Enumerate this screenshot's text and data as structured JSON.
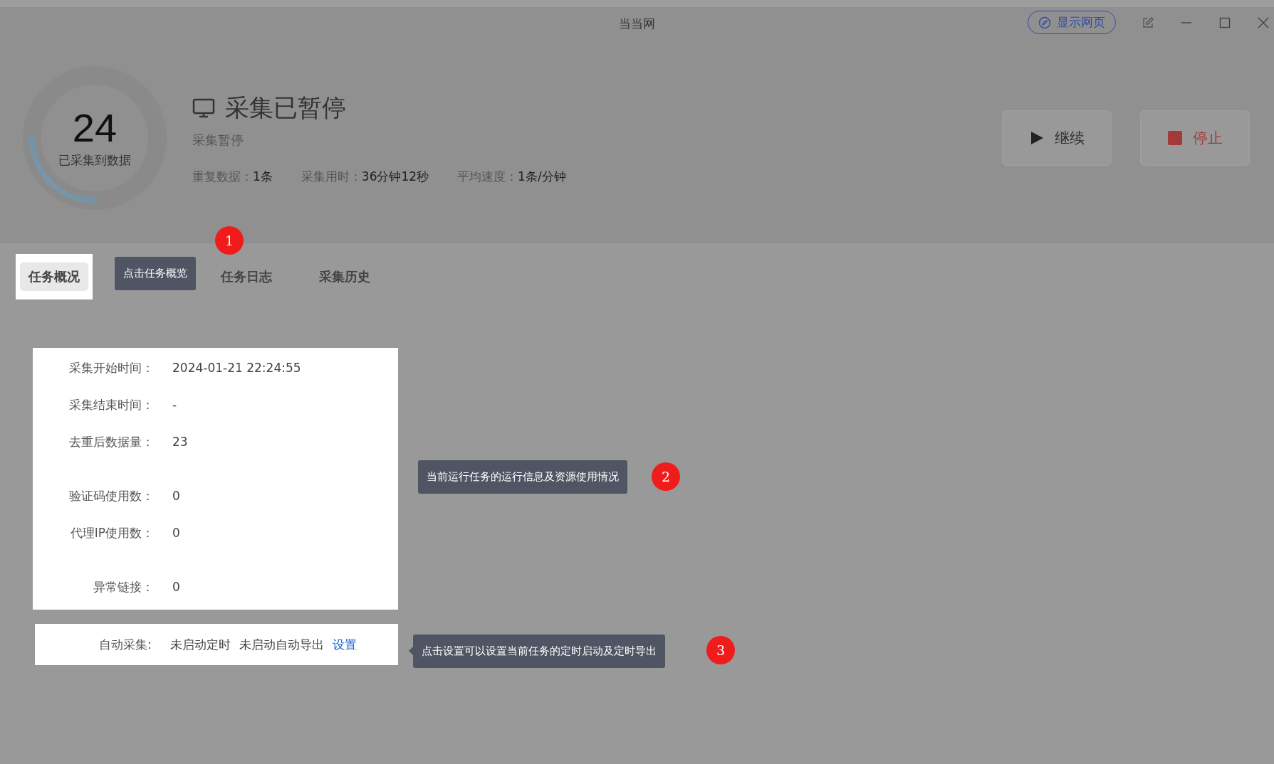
{
  "window": {
    "title": "当当网",
    "show_page_button": "显示网页"
  },
  "progress": {
    "count": "24",
    "label": "已采集到数据",
    "level": 0.25
  },
  "status": {
    "title": "采集已暂停",
    "subtitle": "采集暂停",
    "stats": [
      {
        "label": "重复数据：",
        "value": "1条"
      },
      {
        "label": "采集用时：",
        "value": "36分钟12秒"
      },
      {
        "label": "平均速度：",
        "value": "1条/分钟"
      }
    ]
  },
  "actions": [
    {
      "kind": "resume",
      "label": "继续"
    },
    {
      "kind": "stop",
      "label": "停止"
    }
  ],
  "tabs": [
    {
      "label": "任务概况",
      "selected": true
    },
    {
      "label": "任务日志",
      "selected": false
    },
    {
      "label": "采集历史",
      "selected": false
    }
  ],
  "info_groups": [
    [
      {
        "label": "采集开始时间：",
        "value": "2024-01-21 22:24:55"
      },
      {
        "label": "采集结束时间：",
        "value": "-"
      },
      {
        "label": "去重后数据量：",
        "value": "23"
      }
    ],
    [
      {
        "label": "验证码使用数：",
        "value": "0"
      },
      {
        "label": "代理IP使用数：",
        "value": "0"
      }
    ],
    [
      {
        "label": "异常链接：",
        "value": "0"
      }
    ]
  ],
  "auto_collect": {
    "label": "自动采集:",
    "statuses": [
      "未启动定时",
      "未启动自动导出"
    ],
    "link": "设置"
  },
  "guide_tips": [
    {
      "number": "1",
      "text": "点击任务概览"
    },
    {
      "number": "2",
      "text": "当前运行任务的运行信息及资源使用情况"
    },
    {
      "number": "3",
      "text": "点击设置可以设置当前任务的定时启动及定时导出"
    }
  ]
}
